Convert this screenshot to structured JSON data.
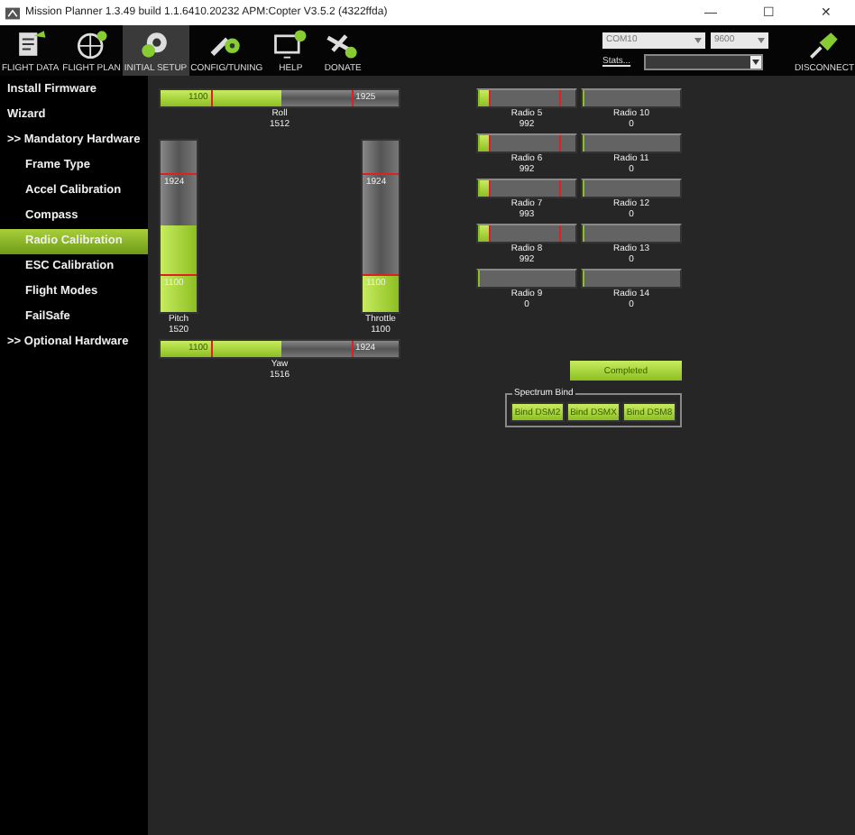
{
  "window": {
    "title": "Mission Planner 1.3.49 build 1.1.6410.20232 APM:Copter V3.5.2 (4322ffda)",
    "minimize": "—",
    "maximize": "☐",
    "close": "✕"
  },
  "toolbar": [
    {
      "label": "FLIGHT DATA",
      "kind": "data",
      "selected": false
    },
    {
      "label": "FLIGHT PLAN",
      "kind": "plan",
      "selected": false
    },
    {
      "label": "INITIAL SETUP",
      "kind": "setup",
      "selected": true
    },
    {
      "label": "CONFIG/TUNING",
      "kind": "config",
      "selected": false
    },
    {
      "label": "HELP",
      "kind": "help",
      "selected": false
    },
    {
      "label": "DONATE",
      "kind": "donate",
      "selected": false
    }
  ],
  "connection": {
    "port": "COM10",
    "baud": "9600",
    "stats": "Stats...",
    "disconnect": "DISCONNECT"
  },
  "sidebar": {
    "items": [
      {
        "label": "Install Firmware",
        "selected": false
      },
      {
        "label": "Wizard",
        "selected": false
      },
      {
        "label": ">> Mandatory Hardware",
        "selected": false,
        "children": [
          {
            "label": "Frame Type",
            "selected": false
          },
          {
            "label": "Accel Calibration",
            "selected": false
          },
          {
            "label": "Compass",
            "selected": false
          },
          {
            "label": "Radio Calibration",
            "selected": true
          },
          {
            "label": "ESC Calibration",
            "selected": false
          },
          {
            "label": "Flight Modes",
            "selected": false
          },
          {
            "label": "FailSafe",
            "selected": false
          }
        ]
      },
      {
        "label": ">> Optional Hardware",
        "selected": false
      }
    ]
  },
  "sticks": [
    {
      "name": "Roll",
      "value": "1512",
      "level": 0.51,
      "min": "1100",
      "max": "1925"
    },
    {
      "name": "Pitch",
      "value": "1520",
      "level": 0.51,
      "min": "1100",
      "max": "1924"
    },
    {
      "name": "Throttle",
      "value": "1100",
      "level": 0.21,
      "min": "1100",
      "max": "1924"
    },
    {
      "name": "Yaw",
      "value": "1516",
      "level": 0.51,
      "min": "1100",
      "max": "1924"
    }
  ],
  "radios": [
    {
      "name": "Radio 5",
      "value": "992",
      "level": 0.12,
      "kind": "calibrated"
    },
    {
      "name": "Radio 6",
      "value": "992",
      "level": 0.12,
      "kind": "calibrated"
    },
    {
      "name": "Radio 7",
      "value": "993",
      "level": 0.12,
      "kind": "calibrated"
    },
    {
      "name": "Radio 8",
      "value": "992",
      "level": 0.12,
      "kind": "calibrated"
    },
    {
      "name": "Radio 9",
      "value": "0",
      "level": 0,
      "kind": "idle"
    },
    {
      "name": "Radio 10",
      "value": "0",
      "level": 0,
      "kind": "idle"
    },
    {
      "name": "Radio 11",
      "value": "0",
      "level": 0,
      "kind": "idle"
    },
    {
      "name": "Radio 12",
      "value": "0",
      "level": 0,
      "kind": "idle"
    },
    {
      "name": "Radio 13",
      "value": "0",
      "level": 0,
      "kind": "idle"
    },
    {
      "name": "Radio 14",
      "value": "0",
      "level": 0,
      "kind": "idle"
    }
  ],
  "calibrate_button": "Completed",
  "spectrum_bind": {
    "title": "Spectrum Bind",
    "buttons": [
      "Bind DSM2",
      "Bind DSMX",
      "Bind DSM8"
    ]
  }
}
